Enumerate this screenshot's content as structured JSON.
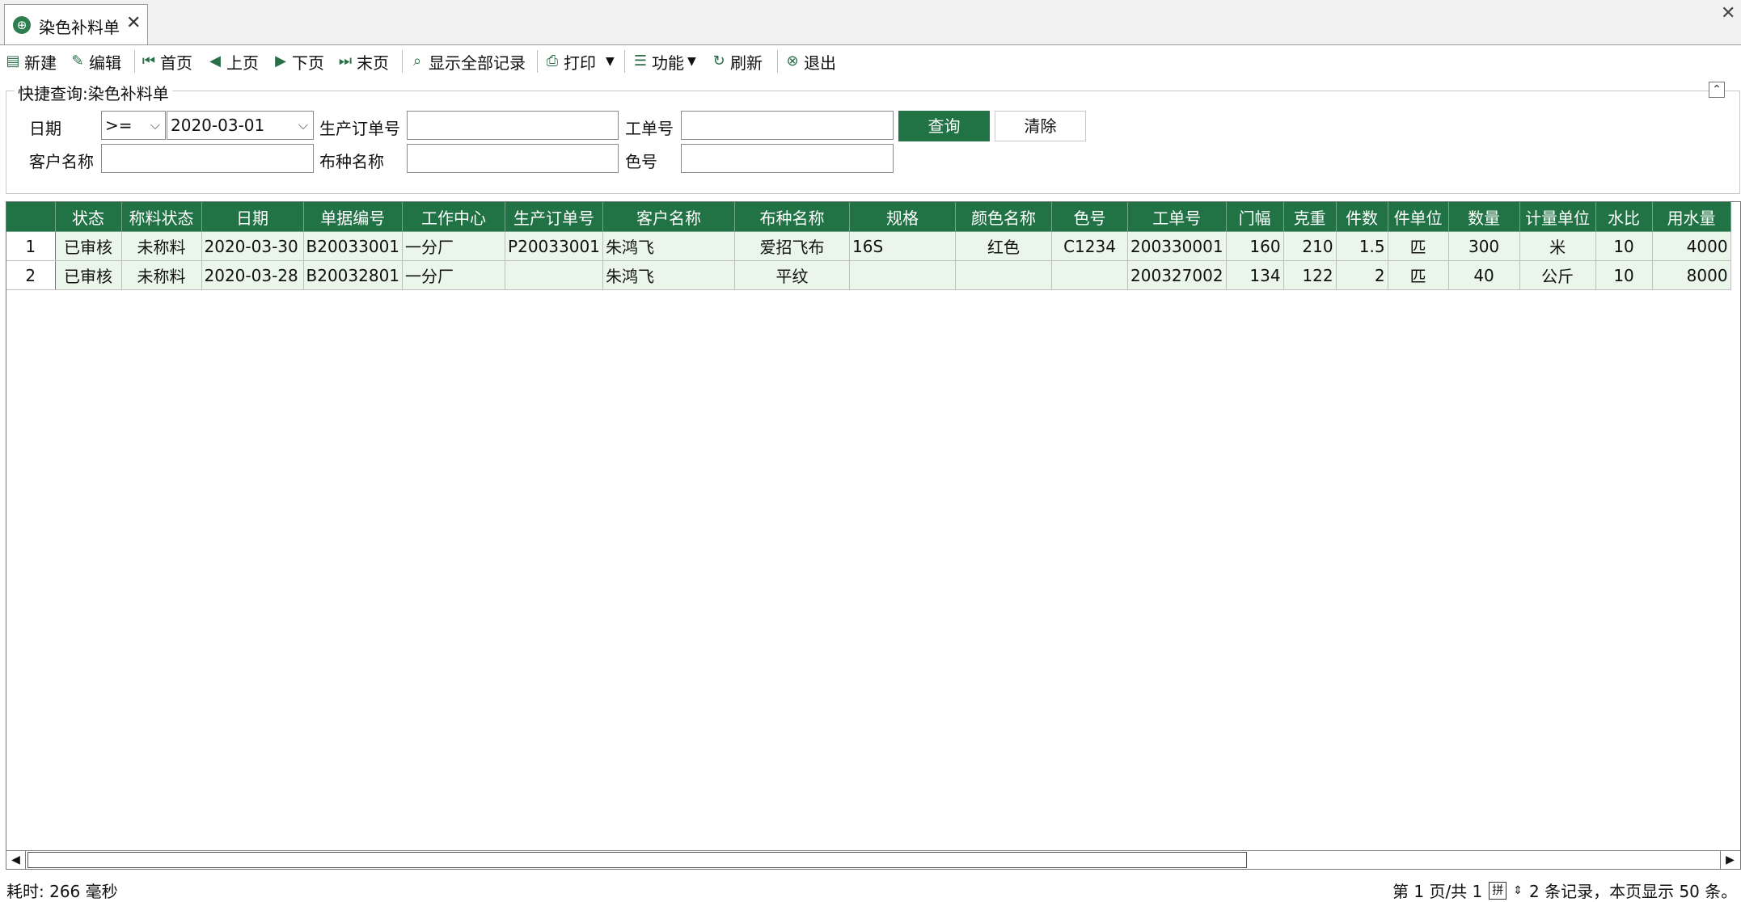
{
  "tab": {
    "title": "染色补料单",
    "close": "✕",
    "icon": "globe-icon"
  },
  "window_close": "✕",
  "toolbar": {
    "new": "新建",
    "edit": "编辑",
    "first": "首页",
    "prev": "上页",
    "next": "下页",
    "last": "末页",
    "show_all": "显示全部记录",
    "print": "打印",
    "function": "功能",
    "refresh": "刷新",
    "exit": "退出"
  },
  "query": {
    "title": "快捷查询:染色补料单",
    "collapse": "⌃",
    "date_label": "日期",
    "date_op": ">=",
    "date_value": "2020-03-01",
    "order_label": "生产订单号",
    "order_value": "",
    "job_label": "工单号",
    "job_value": "",
    "customer_label": "客户名称",
    "customer_value": "",
    "fabric_label": "布种名称",
    "fabric_value": "",
    "color_no_label": "色号",
    "color_no_value": "",
    "query_btn": "查询",
    "clear_btn": "清除"
  },
  "grid": {
    "headers": [
      "状态",
      "称料状态",
      "日期",
      "单据编号",
      "工作中心",
      "生产订单号",
      "客户名称",
      "布种名称",
      "规格",
      "颜色名称",
      "色号",
      "工单号",
      "门幅",
      "克重",
      "件数",
      "件单位",
      "数量",
      "计量单位",
      "水比",
      "用水量"
    ],
    "rows": [
      {
        "n": "1",
        "cells": [
          "已审核",
          "未称料",
          "2020-03-30",
          "B20033001",
          "一分厂",
          "P20033001",
          "朱鸿飞",
          "爱招飞布",
          "16S",
          "红色",
          "C1234",
          "200330001",
          "160",
          "210",
          "1.5",
          "匹",
          "300",
          "米",
          "10",
          "4000"
        ]
      },
      {
        "n": "2",
        "cells": [
          "已审核",
          "未称料",
          "2020-03-28",
          "B20032801",
          "一分厂",
          "",
          "朱鸿飞",
          "平纹",
          "",
          "",
          "",
          "200327002",
          "134",
          "122",
          "2",
          "匹",
          "40",
          "公斤",
          "10",
          "8000"
        ]
      }
    ]
  },
  "status": {
    "elapsed": "耗时: 266 毫秒",
    "page": "第 1 页/共 1",
    "records": "2 条记录，本页显示 50 条。"
  }
}
